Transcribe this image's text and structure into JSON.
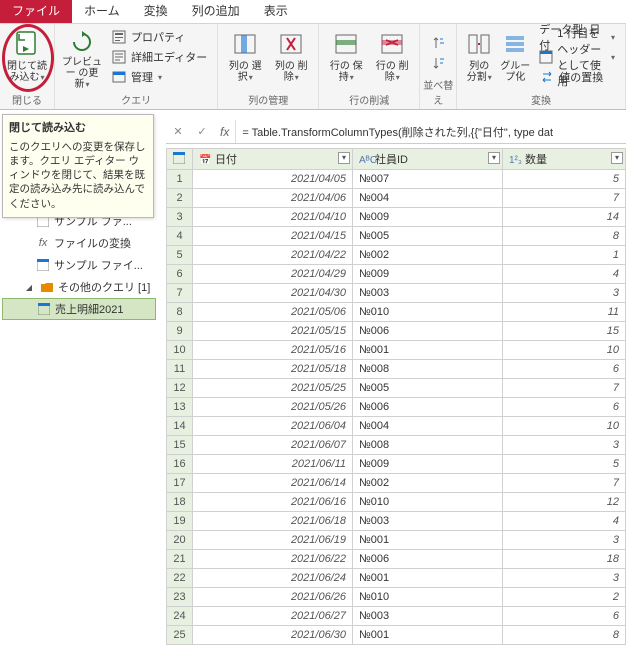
{
  "tabs": {
    "file": "ファイル",
    "home": "ホーム",
    "transform": "変換",
    "addcol": "列の追加",
    "view": "表示"
  },
  "ribbon": {
    "close": {
      "label": "閉じて読\nみ込む",
      "group": "閉じる"
    },
    "preview": {
      "label": "プレビュー\nの更新"
    },
    "properties": "プロパティ",
    "advanced": "詳細エディター",
    "manage": "管理",
    "queryGroup": "クエリ",
    "selCols": "列の\n選択",
    "remCols": "列の\n削除",
    "colMgmt": "列の管理",
    "keepRows": "行の\n保持",
    "remRows": "行の\n削除",
    "rowRed": "行の削減",
    "sortAsc": "↕",
    "sortGroup": "並べ替え",
    "splitCol": "列の\n分割",
    "groupBy": "グルー\nプ化",
    "dataType": "データ型: 日付",
    "useFirstRow": "1 行目をヘッダーとして使用",
    "replace": "値の置換",
    "transformGroup": "変換"
  },
  "tooltip": {
    "title": "閉じて読み込む",
    "body": "このクエリへの変更を保存します。クエリ エディター ウィンドウを閉じて、結果を既定の読み込み先に読み込んでください。"
  },
  "queries": {
    "sampleFile": "サンプル ファ...",
    "fileConv": "ファイルの変換",
    "sampleFile2": "サンプル ファイ...",
    "other": "その他のクエリ [1]",
    "sales": "売上明細2021"
  },
  "formulaBar": {
    "formula": "= Table.TransformColumnTypes(削除された列,{{\"日付\", type dat"
  },
  "grid": {
    "headers": {
      "date": "日付",
      "emp": "社員ID",
      "qty": "数量"
    },
    "typeIcons": {
      "date": "📅",
      "emp": "AᴮC",
      "qty": "1²₃"
    }
  },
  "chart_data": {
    "type": "table",
    "columns": [
      "日付",
      "社員ID",
      "数量"
    ],
    "rows": [
      [
        "2021/04/05",
        "№007",
        5
      ],
      [
        "2021/04/06",
        "№004",
        7
      ],
      [
        "2021/04/10",
        "№009",
        14
      ],
      [
        "2021/04/15",
        "№005",
        8
      ],
      [
        "2021/04/22",
        "№002",
        1
      ],
      [
        "2021/04/29",
        "№009",
        4
      ],
      [
        "2021/04/30",
        "№003",
        3
      ],
      [
        "2021/05/06",
        "№010",
        11
      ],
      [
        "2021/05/15",
        "№006",
        15
      ],
      [
        "2021/05/16",
        "№001",
        10
      ],
      [
        "2021/05/18",
        "№008",
        6
      ],
      [
        "2021/05/25",
        "№005",
        7
      ],
      [
        "2021/05/26",
        "№006",
        6
      ],
      [
        "2021/06/04",
        "№004",
        10
      ],
      [
        "2021/06/07",
        "№008",
        3
      ],
      [
        "2021/06/11",
        "№009",
        5
      ],
      [
        "2021/06/14",
        "№002",
        7
      ],
      [
        "2021/06/16",
        "№010",
        12
      ],
      [
        "2021/06/18",
        "№003",
        4
      ],
      [
        "2021/06/19",
        "№001",
        3
      ],
      [
        "2021/06/22",
        "№006",
        18
      ],
      [
        "2021/06/24",
        "№001",
        3
      ],
      [
        "2021/06/26",
        "№010",
        2
      ],
      [
        "2021/06/27",
        "№003",
        6
      ],
      [
        "2021/06/30",
        "№001",
        8
      ]
    ]
  }
}
